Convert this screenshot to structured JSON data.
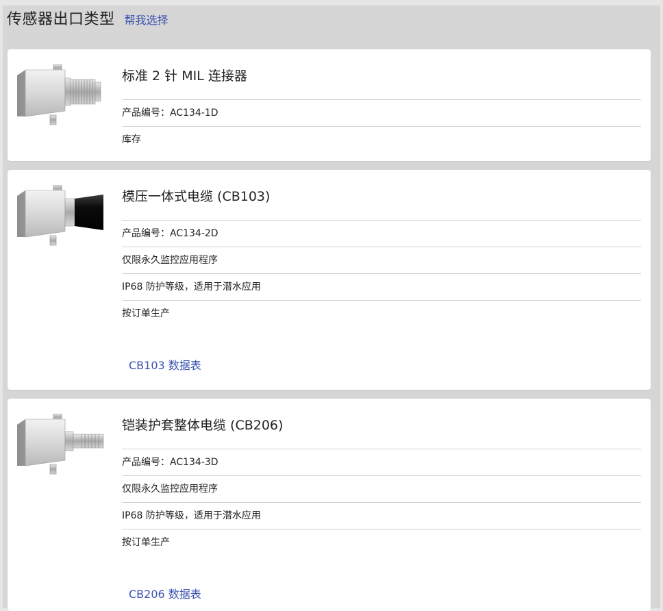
{
  "header": {
    "title": "传感器出口类型",
    "help_link": "帮我选择"
  },
  "products": [
    {
      "title": "标准 2 针 MIL 连接器",
      "part_number": "产品编号：AC134-1D",
      "lines": [
        "库存"
      ],
      "connector_image": "sensor-mil-connector-icon"
    },
    {
      "title": "模压一体式电缆 (CB103)",
      "part_number": "产品编号：AC134-2D",
      "lines": [
        "仅限永久监控应用程序",
        "IP68 防护等级，适用于潜水应用",
        "按订单生产"
      ],
      "datasheet": "CB103 数据表",
      "connector_image": "sensor-molded-cable-icon"
    },
    {
      "title": "铠装护套整体电缆 (CB206)",
      "part_number": "产品编号：AC134-3D",
      "lines": [
        "仅限永久监控应用程序",
        "IP68 防护等级，适用于潜水应用",
        "按订单生产"
      ],
      "datasheet": "CB206 数据表",
      "connector_image": "sensor-armored-cable-icon"
    }
  ],
  "colors": {
    "link": "#3a53b0",
    "panel_bg": "#d6d6d6",
    "card_bg": "#ffffff",
    "divider": "#cfcfcf"
  }
}
